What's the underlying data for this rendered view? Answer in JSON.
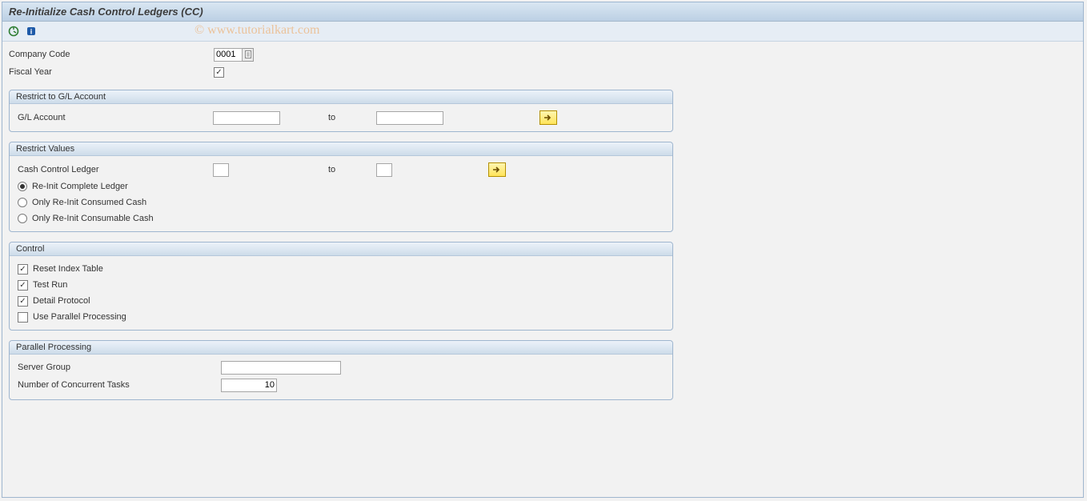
{
  "title": "Re-Initialize Cash Control Ledgers (CC)",
  "watermark": "© www.tutorialkart.com",
  "header": {
    "company_code_label": "Company Code",
    "company_code_value": "0001",
    "fiscal_year_label": "Fiscal Year",
    "fiscal_year_checked": true
  },
  "group_gl": {
    "title": "Restrict to G/L Account",
    "label": "G/L Account",
    "from": "",
    "to_label": "to",
    "to": ""
  },
  "group_values": {
    "title": "Restrict Values",
    "ledger_label": "Cash Control Ledger",
    "ledger_from": "",
    "to_label": "to",
    "ledger_to": "",
    "options": [
      {
        "label": "Re-Init Complete Ledger",
        "checked": true
      },
      {
        "label": "Only Re-Init Consumed Cash",
        "checked": false
      },
      {
        "label": "Only Re-Init Consumable Cash",
        "checked": false
      }
    ]
  },
  "group_control": {
    "title": "Control",
    "checks": [
      {
        "label": "Reset Index Table",
        "checked": true
      },
      {
        "label": "Test Run",
        "checked": true
      },
      {
        "label": "Detail Protocol",
        "checked": true
      },
      {
        "label": "Use Parallel Processing",
        "checked": false
      }
    ]
  },
  "group_parallel": {
    "title": "Parallel Processing",
    "server_group_label": "Server Group",
    "server_group_value": "",
    "concurrent_label": "Number of Concurrent Tasks",
    "concurrent_value": "10"
  }
}
